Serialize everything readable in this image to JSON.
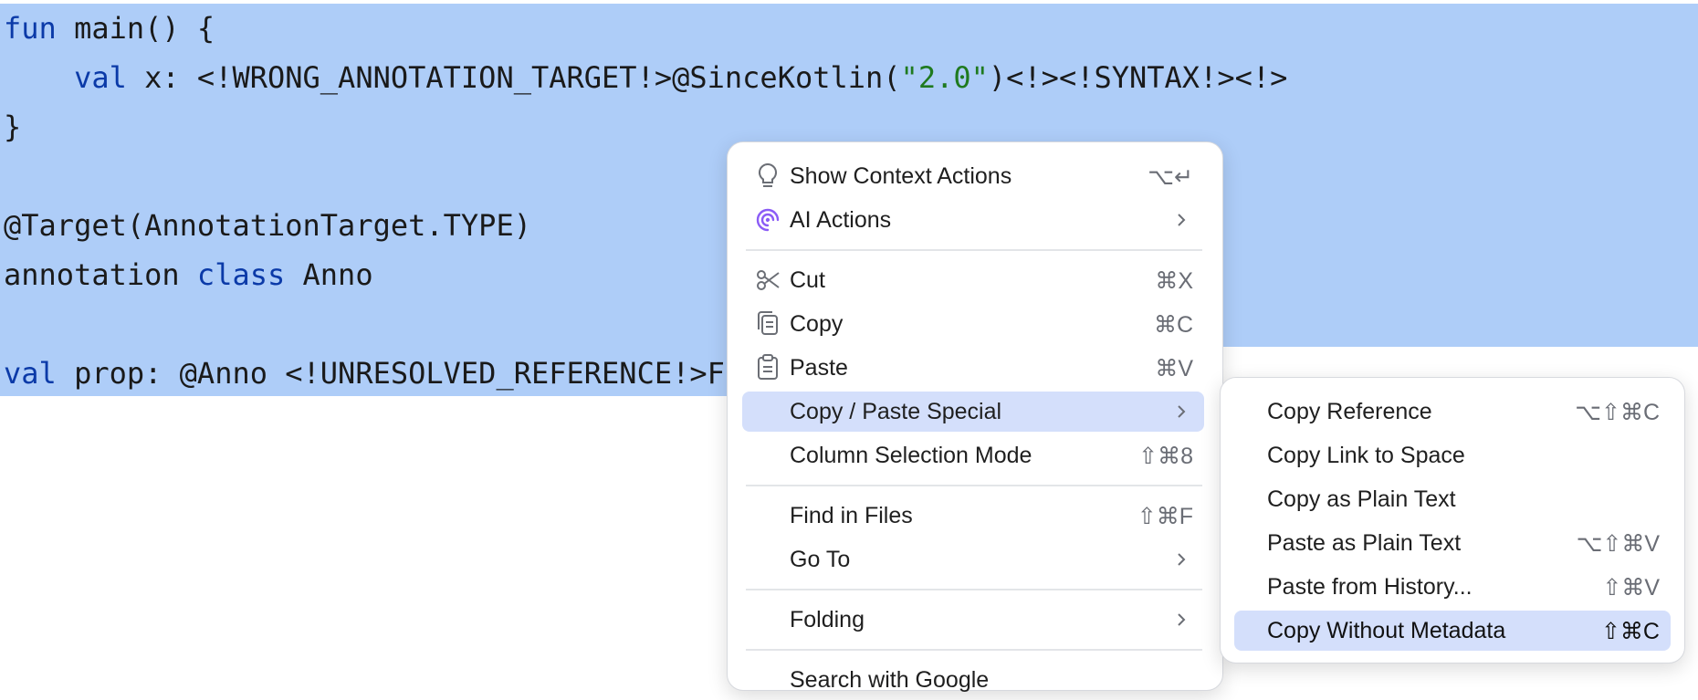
{
  "code": {
    "line1": {
      "kw": "fun",
      "rest": " main() {"
    },
    "line2": {
      "indent": "    ",
      "kw": "val",
      "pre": " x: <!WRONG_ANNOTATION_TARGET!>@SinceKotlin(",
      "str": "\"2.0\"",
      "post": ")<!><!SYNTAX!><!>"
    },
    "line3": "}",
    "line5": "@Target(AnnotationTarget.TYPE)",
    "line6": {
      "pre": "annotation ",
      "kw": "class",
      "post": " Anno"
    },
    "line8": {
      "kw": "val",
      "rest": " prop: @Anno <!UNRESOLVED_REFERENCE!>Fo"
    }
  },
  "context_menu": {
    "items": [
      {
        "label": "Show Context Actions",
        "shortcut": "⌥↵",
        "icon": "lightbulb-icon"
      },
      {
        "label": "AI Actions",
        "icon": "ai-spiral-icon",
        "submenu": true
      },
      {
        "label": "Cut",
        "shortcut": "⌘X",
        "icon": "scissors-icon"
      },
      {
        "label": "Copy",
        "shortcut": "⌘C",
        "icon": "copy-icon"
      },
      {
        "label": "Paste",
        "shortcut": "⌘V",
        "icon": "paste-icon"
      },
      {
        "label": "Copy / Paste Special",
        "submenu": true,
        "highlighted": true
      },
      {
        "label": "Column Selection Mode",
        "shortcut": "⇧⌘8"
      },
      {
        "label": "Find in Files",
        "shortcut": "⇧⌘F"
      },
      {
        "label": "Go To",
        "submenu": true
      },
      {
        "label": "Folding",
        "submenu": true
      },
      {
        "label": "Search with Google"
      }
    ]
  },
  "submenu": {
    "items": [
      {
        "label": "Copy Reference",
        "shortcut": "⌥⇧⌘C"
      },
      {
        "label": "Copy Link to Space",
        "shortcut": ""
      },
      {
        "label": "Copy as Plain Text",
        "shortcut": ""
      },
      {
        "label": "Paste as Plain Text",
        "shortcut": "⌥⇧⌘V"
      },
      {
        "label": "Paste from History...",
        "shortcut": "⇧⌘V"
      },
      {
        "label": "Copy Without Metadata",
        "shortcut": "⇧⌘C",
        "highlighted": true
      }
    ]
  },
  "colors": {
    "selection": "#aecdf8",
    "keyword": "#0b3aa8",
    "string": "#1f7a1f",
    "menu_highlight": "#d4dffb",
    "ai_icon": "#8b5cf6"
  }
}
